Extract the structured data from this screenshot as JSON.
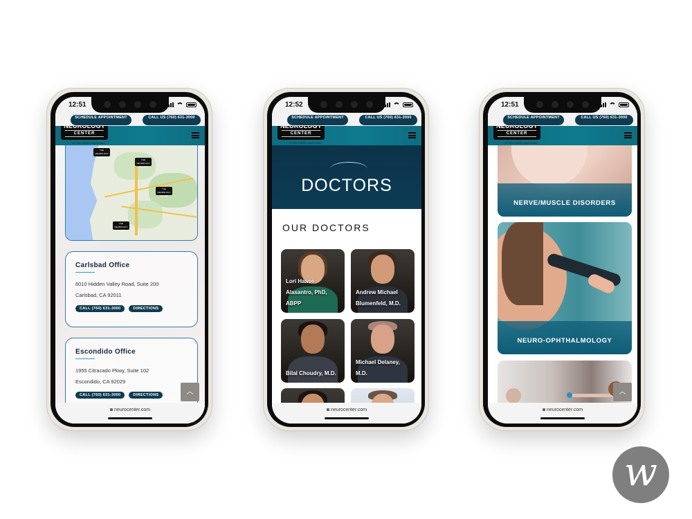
{
  "colors": {
    "navy": "#0f3b52",
    "teal": "#0e7a8e",
    "link": "#2f7ea6"
  },
  "site": {
    "schedule_label": "SCHEDULE APPOINTMENT",
    "call_label": "CALL US (760) 631-3000",
    "url": "neurocenter.com",
    "logo": {
      "line1": "THE",
      "line2": "NEUROLOGY",
      "line3": "CENTER",
      "line4": "OF SOUTHERN CALIFORNIA"
    }
  },
  "phones": [
    {
      "time": "12:51",
      "map_pins": [
        "THE NEUROLOGY CENTER",
        "THE NEUROLOGY CENTER",
        "THE NEUROLOGY CENTER",
        "THE NEUROLOGY CENTER"
      ],
      "offices": [
        {
          "name": "Carlsbad Office",
          "address1": "6010 Hidden Valley Road, Suite 200",
          "address2": "Carlsbad, CA 92011",
          "call": "CALL (760) 631-3000",
          "directions": "DIRECTIONS"
        },
        {
          "name": "Escondido Office",
          "address1": "1955 Citracado Pkwy, Suite 102",
          "address2": "Escondido, CA 92029",
          "call": "CALL (760) 631-3000",
          "directions": "DIRECTIONS"
        }
      ],
      "scroll_top_icon": "chevron-up-icon"
    },
    {
      "time": "12:52",
      "hero_title": "DOCTORS",
      "section_title": "OUR DOCTORS",
      "doctors": [
        {
          "name": "Lori Haase Alasantro, PhD, ABPP"
        },
        {
          "name": "Andrew Michael Blumenfeld, M.D."
        },
        {
          "name": "Bilal Choudry, M.D."
        },
        {
          "name": "Michael Delaney, M.D."
        }
      ]
    },
    {
      "time": "12:51",
      "services": [
        {
          "label": "NERVE/MUSCLE DISORDERS"
        },
        {
          "label": "NEURO-OPHTHALMOLOGY"
        }
      ],
      "scroll_top_icon": "chevron-up-icon"
    }
  ],
  "brand_badge": {
    "letter": "w",
    "icon": "w-logo-icon"
  }
}
